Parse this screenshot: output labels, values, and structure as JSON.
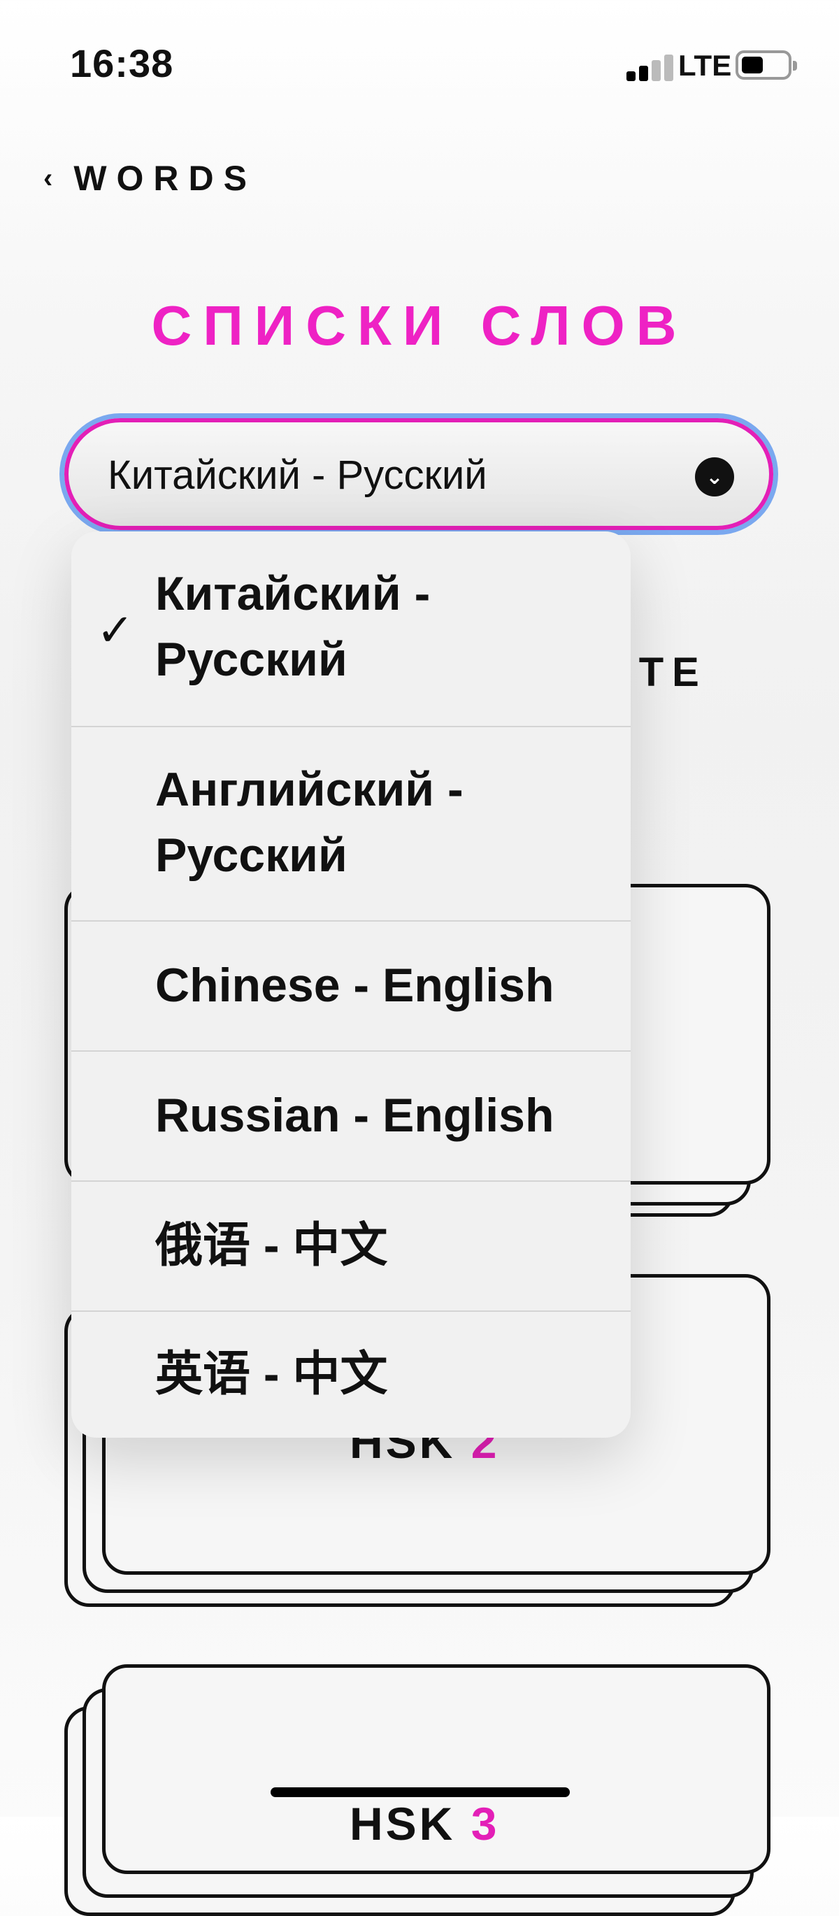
{
  "status_bar": {
    "time": "16:38",
    "network": "LTE"
  },
  "nav": {
    "back_label": "WORDS",
    "back_icon": "chevron-left-icon"
  },
  "page": {
    "title": "СПИСКИ СЛОВ",
    "partial_heading": "ЙТЕ"
  },
  "language_select": {
    "selected": "Китайский - Русский",
    "caret_icon": "chevron-down-circle-icon",
    "options": [
      {
        "label": "Китайский - Русский",
        "selected": true
      },
      {
        "label": "Английский - Русский",
        "selected": false
      },
      {
        "label": "Chinese - English",
        "selected": false
      },
      {
        "label": "Russian - English",
        "selected": false
      },
      {
        "label": "俄语 - 中文",
        "selected": false
      },
      {
        "label": "英语 - 中文",
        "selected": false
      }
    ],
    "check_icon": "checkmark-icon"
  },
  "cards": [
    {
      "prefix": "HSK",
      "number": "2"
    },
    {
      "prefix": "HSK",
      "number": "3"
    }
  ],
  "colors": {
    "accent": "#ee22c4",
    "focus_ring": "#7aa8ef"
  }
}
